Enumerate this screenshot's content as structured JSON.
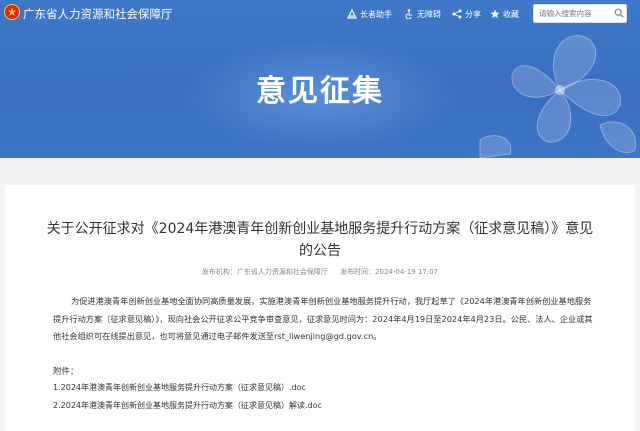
{
  "header": {
    "site_title": "广东省人力资源和社会保障厅",
    "tools": {
      "accessibility": "长者助手",
      "barrier_free": "无障碍",
      "share": "分享",
      "favorite": "收藏"
    },
    "search": {
      "placeholder": "请输入搜索内容",
      "value": ""
    }
  },
  "banner": {
    "title": "意见征集"
  },
  "article": {
    "title": "关于公开征求对《2024年港澳青年创新创业基地服务提升行动方案（征求意见稿）》意见的公告",
    "publisher": "发布机构：广东省人力资源和社会保障厅",
    "publish_time": "发布时间：2024-04-19 17:07",
    "body": "为促进港澳青年创新创业基地全面协同高质量发展，实施港澳青年创新创业基地服务提升行动，我厅起草了《2024年港澳青年创新创业基地服务提升行动方案（征求意见稿）》，现向社会公开征求公平竞争审查意见，征求意见时间为：2024年4月19日至2024年4月23日。公民、法人、企业或其他社会组织可在线提出意见，也可将意见通过电子邮件发送至rst_liwenjing@gd.gov.cn。",
    "attachments_label": "附件：",
    "attachments": [
      "1.2024年港澳青年创新创业基地服务提升行动方案（征求意见稿）.doc",
      "2.2024年港澳青年创新创业基地服务提升行动方案（征求意见稿）解读.doc"
    ]
  },
  "colors": {
    "banner_blue": "#3a6fc0",
    "text": "#333333"
  }
}
